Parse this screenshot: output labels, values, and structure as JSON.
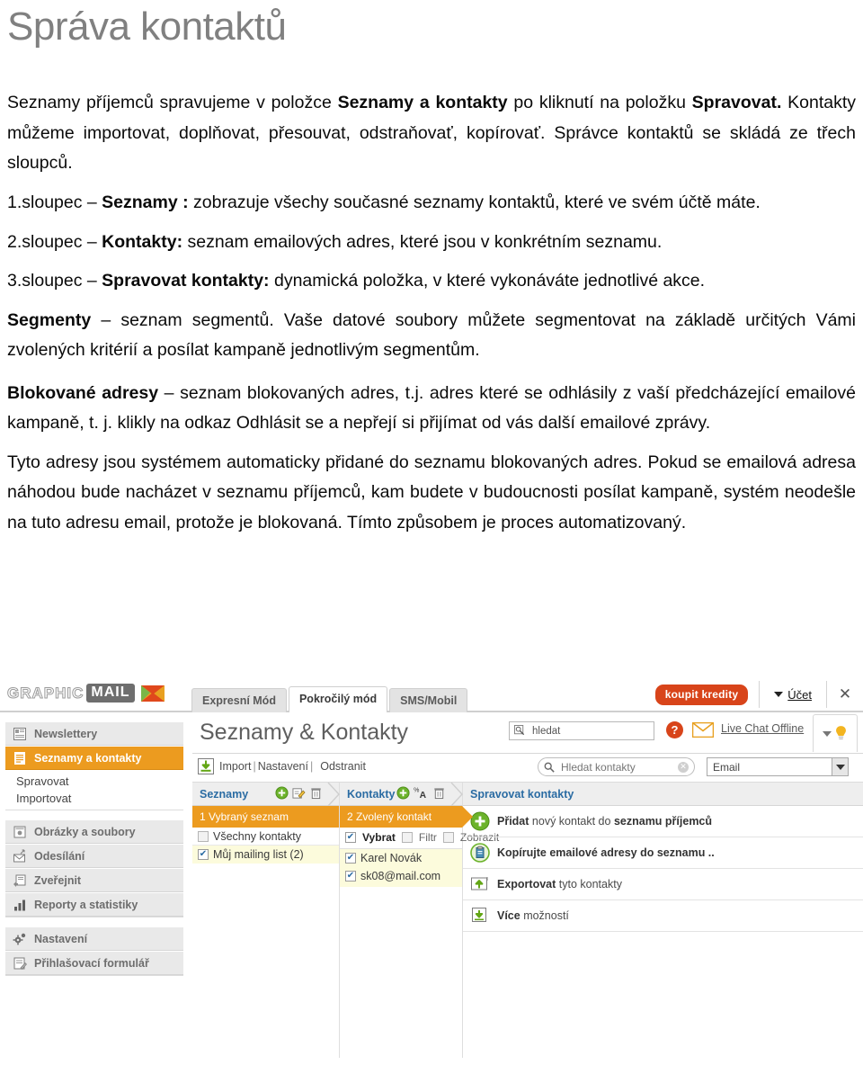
{
  "document": {
    "title": "Správa kontaktů",
    "intro": {
      "before_1": "Seznamy příjemců spravujeme v položce ",
      "bold_1": "Seznamy a kontakty",
      "mid_1": " po kliknutí na položku ",
      "bold_2": "Spravovat.",
      "rest": " Kontakty můžeme importovat, doplňovat, přesouvat, odstraňovať, kopírovať. Správce kontaktů se skládá ze třech sloupců."
    },
    "list": [
      {
        "num": "1.sloupec – ",
        "bold": "Seznamy :",
        "text": " zobrazuje všechy současné seznamy kontaktů, které ve svém účtě máte."
      },
      {
        "num": "2.sloupec – ",
        "bold": "Kontakty:",
        "text": " seznam emailových adres, které jsou v konkrétním seznamu."
      },
      {
        "num": "3.sloupec – ",
        "bold": "Spravovat kontakty:",
        "text": " dynamická položka, v které vykonáváte jednotlivé akce."
      }
    ],
    "segmenty": {
      "bold": "Segmenty",
      "text": " – seznam segmentů. Vaše datové soubory můžete segmentovat na základě určitých Vámi zvolených kritérií a posílat kampaně jednotlivým segmentům."
    },
    "blokovane": {
      "bold": "Blokované adresy",
      "text": " – seznam blokovaných adres, t.j. adres které se odhlásily z vaší předcházející emailové kampaně, t. j. klikly na odkaz Odhlásit se a nepřejí si přijímat od vás další emailové zprávy."
    },
    "closing": "Tyto adresy jsou systémem automaticky přidané do seznamu blokovaných adres. Pokud se emailová adresa náhodou bude nacházet v seznamu příjemců, kam budete v budoucnosti posílat kampaně, systém neodešle na tuto adresu email, protože je blokovaná. Tímto způsobem je proces automatizovaný."
  },
  "app": {
    "logo": {
      "part1": "GRAPHIC",
      "part2": "MAIL",
      "envelope_icon": "envelope-icon"
    },
    "tabs": [
      {
        "label": "Expresní Mód",
        "active": false
      },
      {
        "label": "Pokročilý mód",
        "active": true
      },
      {
        "label": "SMS/Mobil",
        "active": false
      }
    ],
    "topright": {
      "credits_button": "koupit kredity",
      "account_label": "Účet",
      "caret_icon": "caret-down-icon",
      "close_icon": "close-icon"
    },
    "sidebar": {
      "groups": [
        {
          "items": [
            {
              "label": "Newslettery",
              "icon": "newsletter-icon",
              "active": false
            },
            {
              "label": "Seznamy a kontakty",
              "icon": "contacts-list-icon",
              "active": true
            }
          ],
          "subitems": [
            "Spravovat",
            "Importovat"
          ]
        },
        {
          "items": [
            {
              "label": "Obrázky a soubory",
              "icon": "image-file-icon",
              "active": false
            },
            {
              "label": "Odesílání",
              "icon": "send-mail-icon",
              "active": false
            },
            {
              "label": "Zveřejnit",
              "icon": "publish-icon",
              "active": false
            },
            {
              "label": "Reporty a statistiky",
              "icon": "bar-chart-icon",
              "active": false
            }
          ],
          "subitems": []
        },
        {
          "items": [
            {
              "label": "Nastavení",
              "icon": "gear-icon",
              "active": false
            },
            {
              "label": "Přihlašovací formulář",
              "icon": "signup-form-icon",
              "active": false
            }
          ],
          "subitems": []
        }
      ]
    },
    "main": {
      "page_title": "Seznamy & Kontakty",
      "search": {
        "value": "hledat",
        "icon": "search-icon"
      },
      "help_icon_label": "?",
      "mail_icon": "envelope-icon",
      "live_chat": "Live Chat Offline",
      "bulb_icon": "lightbulb-icon",
      "toolbar": {
        "import_icon": "import-download-icon",
        "links": [
          "Import",
          "Nastavení",
          "Odstranit"
        ],
        "separator": "|"
      },
      "contacts_search": {
        "placeholder": "Hledat kontakty",
        "icon": "search-icon",
        "clear_icon": "clear-circle-icon"
      },
      "field_select": {
        "value": "Email",
        "arrow_icon": "chevron-down-icon"
      }
    },
    "columns": [
      {
        "title": "Seznamy",
        "icons": [
          "add-icon",
          "edit-icon",
          "delete-icon"
        ],
        "step": "1 Vybraný seznam",
        "rows": [
          {
            "label": "Všechny kontakty",
            "checked": false,
            "highlight": false
          },
          {
            "label": "Můj mailing list (2)",
            "checked": true,
            "highlight": true
          }
        ]
      },
      {
        "title": "Kontakty",
        "icons": [
          "add-icon",
          "sort-az-icon",
          "delete-icon"
        ],
        "step": "2 Zvolený kontakt",
        "filters": [
          {
            "label": "Vybrat",
            "checked": true
          },
          {
            "label": "Filtr",
            "checked": false
          },
          {
            "label": "Zobrazit",
            "checked": false
          }
        ],
        "rows": [
          {
            "label": "Karel Novák",
            "checked": true,
            "highlight": true
          },
          {
            "label": "sk08@mail.com",
            "checked": true,
            "highlight": true
          }
        ]
      },
      {
        "title": "Spravovat kontakty",
        "icons": [],
        "actions": [
          {
            "icon": "add-circle-icon",
            "bold": "Přidat",
            "mid": " nový kontakt do ",
            "bold2": "seznamu příjemců",
            "tail": ""
          },
          {
            "icon": "copy-clipboard-icon",
            "bold": "Kopírujte emailové adresy do seznamu ..",
            "mid": "",
            "bold2": "",
            "tail": ""
          },
          {
            "icon": "export-upload-icon",
            "bold": "Exportovat",
            "mid": " tyto kontakty",
            "bold2": "",
            "tail": ""
          },
          {
            "icon": "more-options-icon",
            "bold": "Více",
            "mid": " možností",
            "bold2": "",
            "tail": ""
          }
        ]
      }
    ],
    "colors": {
      "orange": "#ec9b1f",
      "red_button": "#d8441a",
      "link_blue": "#2b6ca3",
      "highlight_yellow": "#fcfbdc",
      "title_gray": "#808080"
    }
  }
}
